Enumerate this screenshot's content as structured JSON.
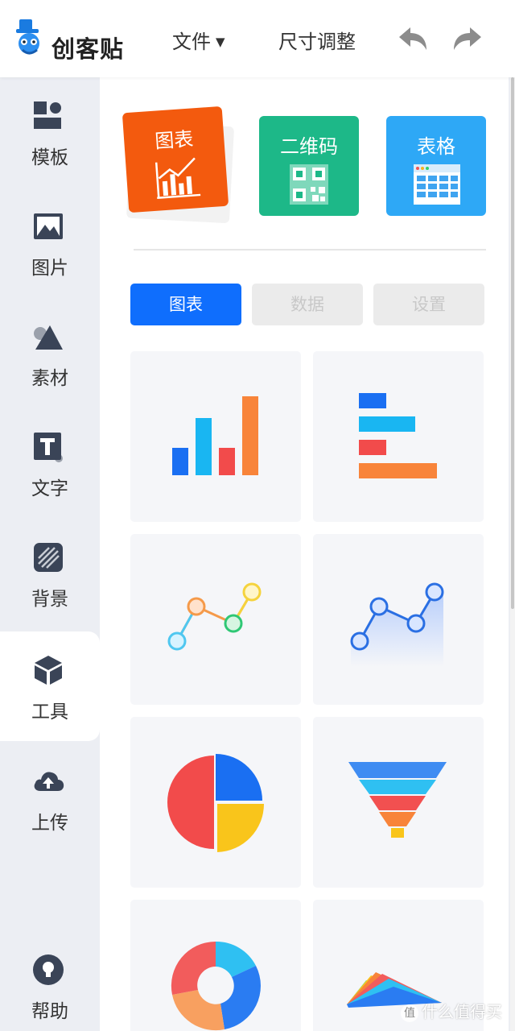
{
  "header": {
    "logo_text": "创客贴",
    "menu_file": "文件",
    "menu_resize": "尺寸调整"
  },
  "sidebar": {
    "items": [
      {
        "label": "模板",
        "icon": "template-icon"
      },
      {
        "label": "图片",
        "icon": "image-icon"
      },
      {
        "label": "素材",
        "icon": "material-icon"
      },
      {
        "label": "文字",
        "icon": "text-icon"
      },
      {
        "label": "背景",
        "icon": "background-icon"
      },
      {
        "label": "工具",
        "icon": "tools-cube-icon",
        "active": true
      },
      {
        "label": "上传",
        "icon": "cloud-upload-icon"
      }
    ],
    "help_label": "帮助"
  },
  "tools": {
    "chart_label": "图表",
    "qrcode_label": "二维码",
    "table_label": "表格"
  },
  "tabs": {
    "chart": "图表",
    "data": "数据",
    "settings": "设置"
  },
  "chart_types": [
    "bar-chart",
    "horizontal-bar-chart",
    "line-chart",
    "area-chart",
    "pie-chart",
    "funnel-chart",
    "donut-chart",
    "rose-chart"
  ],
  "watermark": "什么值得买",
  "colors": {
    "accent": "#0f6efd",
    "chart_tile": "#f35a0e",
    "qrcode_tile": "#1db888",
    "table_tile": "#2ea8f6",
    "sidebar_bg": "#eceef3",
    "icon_dark": "#3a4457"
  }
}
